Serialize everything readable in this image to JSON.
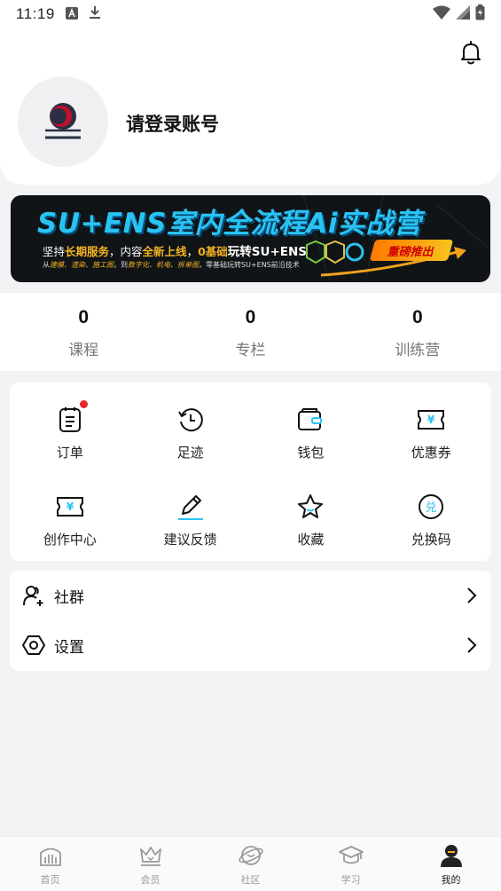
{
  "status_bar": {
    "time": "11:19",
    "icons": [
      "font-icon",
      "download-icon",
      "wifi-icon",
      "signal-icon",
      "battery-icon"
    ]
  },
  "header": {
    "notification_icon": "bell-icon",
    "avatar_icon": "app-logo-avatar",
    "login_text": "请登录账号"
  },
  "banner": {
    "title": "SU+ENS室内全流程Ai实战营",
    "line1_a": "坚持",
    "line1_b": "长期服务",
    "line1_c": "，内容",
    "line1_d": "全新上线",
    "line1_e": "，",
    "line1_f": "0基础",
    "line1_g": "玩转SU+ENS",
    "line2_a": "从",
    "line2_b": "建模、渲染、施工图",
    "line2_c": "，到",
    "line2_d": "数字化、机电、拆单图",
    "line2_e": "，零基础玩转SU+ENS前沿技术",
    "tag": "重磅推出"
  },
  "stats": [
    {
      "value": "0",
      "label": "课程"
    },
    {
      "value": "0",
      "label": "专栏"
    },
    {
      "value": "0",
      "label": "训练营"
    }
  ],
  "grid": [
    {
      "label": "订单",
      "icon": "order-icon",
      "badge": true
    },
    {
      "label": "足迹",
      "icon": "history-icon",
      "badge": false
    },
    {
      "label": "钱包",
      "icon": "wallet-icon",
      "badge": false
    },
    {
      "label": "优惠券",
      "icon": "coupon-icon",
      "badge": false
    },
    {
      "label": "创作中心",
      "icon": "creator-icon",
      "badge": false
    },
    {
      "label": "建议反馈",
      "icon": "feedback-pen-icon",
      "badge": false
    },
    {
      "label": "收藏",
      "icon": "star-icon",
      "badge": false
    },
    {
      "label": "兑换码",
      "icon": "redeem-icon",
      "badge": false
    }
  ],
  "list": [
    {
      "label": "社群",
      "icon": "community-icon"
    },
    {
      "label": "设置",
      "icon": "settings-icon"
    }
  ],
  "tabs": [
    {
      "label": "首页",
      "icon": "home-icon",
      "active": false
    },
    {
      "label": "会员",
      "icon": "crown-icon",
      "active": false
    },
    {
      "label": "社区",
      "icon": "planet-icon",
      "active": false
    },
    {
      "label": "学习",
      "icon": "graduation-cap-icon",
      "active": false
    },
    {
      "label": "我的",
      "icon": "profile-icon",
      "active": true
    }
  ],
  "colors": {
    "accent": "#29c3f2",
    "badge_red": "#e5262b",
    "banner_orange": "#f3b322",
    "page_bg": "#f3f3f5"
  }
}
